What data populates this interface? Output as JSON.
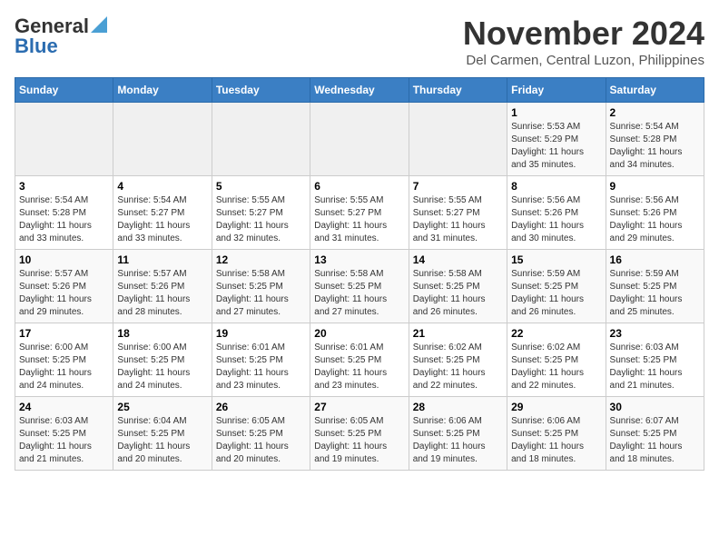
{
  "header": {
    "logo_general": "General",
    "logo_blue": "Blue",
    "month": "November 2024",
    "location": "Del Carmen, Central Luzon, Philippines"
  },
  "days_of_week": [
    "Sunday",
    "Monday",
    "Tuesday",
    "Wednesday",
    "Thursday",
    "Friday",
    "Saturday"
  ],
  "weeks": [
    [
      {
        "day": "",
        "info": ""
      },
      {
        "day": "",
        "info": ""
      },
      {
        "day": "",
        "info": ""
      },
      {
        "day": "",
        "info": ""
      },
      {
        "day": "",
        "info": ""
      },
      {
        "day": "1",
        "info": "Sunrise: 5:53 AM\nSunset: 5:29 PM\nDaylight: 11 hours\nand 35 minutes."
      },
      {
        "day": "2",
        "info": "Sunrise: 5:54 AM\nSunset: 5:28 PM\nDaylight: 11 hours\nand 34 minutes."
      }
    ],
    [
      {
        "day": "3",
        "info": "Sunrise: 5:54 AM\nSunset: 5:28 PM\nDaylight: 11 hours\nand 33 minutes."
      },
      {
        "day": "4",
        "info": "Sunrise: 5:54 AM\nSunset: 5:27 PM\nDaylight: 11 hours\nand 33 minutes."
      },
      {
        "day": "5",
        "info": "Sunrise: 5:55 AM\nSunset: 5:27 PM\nDaylight: 11 hours\nand 32 minutes."
      },
      {
        "day": "6",
        "info": "Sunrise: 5:55 AM\nSunset: 5:27 PM\nDaylight: 11 hours\nand 31 minutes."
      },
      {
        "day": "7",
        "info": "Sunrise: 5:55 AM\nSunset: 5:27 PM\nDaylight: 11 hours\nand 31 minutes."
      },
      {
        "day": "8",
        "info": "Sunrise: 5:56 AM\nSunset: 5:26 PM\nDaylight: 11 hours\nand 30 minutes."
      },
      {
        "day": "9",
        "info": "Sunrise: 5:56 AM\nSunset: 5:26 PM\nDaylight: 11 hours\nand 29 minutes."
      }
    ],
    [
      {
        "day": "10",
        "info": "Sunrise: 5:57 AM\nSunset: 5:26 PM\nDaylight: 11 hours\nand 29 minutes."
      },
      {
        "day": "11",
        "info": "Sunrise: 5:57 AM\nSunset: 5:26 PM\nDaylight: 11 hours\nand 28 minutes."
      },
      {
        "day": "12",
        "info": "Sunrise: 5:58 AM\nSunset: 5:25 PM\nDaylight: 11 hours\nand 27 minutes."
      },
      {
        "day": "13",
        "info": "Sunrise: 5:58 AM\nSunset: 5:25 PM\nDaylight: 11 hours\nand 27 minutes."
      },
      {
        "day": "14",
        "info": "Sunrise: 5:58 AM\nSunset: 5:25 PM\nDaylight: 11 hours\nand 26 minutes."
      },
      {
        "day": "15",
        "info": "Sunrise: 5:59 AM\nSunset: 5:25 PM\nDaylight: 11 hours\nand 26 minutes."
      },
      {
        "day": "16",
        "info": "Sunrise: 5:59 AM\nSunset: 5:25 PM\nDaylight: 11 hours\nand 25 minutes."
      }
    ],
    [
      {
        "day": "17",
        "info": "Sunrise: 6:00 AM\nSunset: 5:25 PM\nDaylight: 11 hours\nand 24 minutes."
      },
      {
        "day": "18",
        "info": "Sunrise: 6:00 AM\nSunset: 5:25 PM\nDaylight: 11 hours\nand 24 minutes."
      },
      {
        "day": "19",
        "info": "Sunrise: 6:01 AM\nSunset: 5:25 PM\nDaylight: 11 hours\nand 23 minutes."
      },
      {
        "day": "20",
        "info": "Sunrise: 6:01 AM\nSunset: 5:25 PM\nDaylight: 11 hours\nand 23 minutes."
      },
      {
        "day": "21",
        "info": "Sunrise: 6:02 AM\nSunset: 5:25 PM\nDaylight: 11 hours\nand 22 minutes."
      },
      {
        "day": "22",
        "info": "Sunrise: 6:02 AM\nSunset: 5:25 PM\nDaylight: 11 hours\nand 22 minutes."
      },
      {
        "day": "23",
        "info": "Sunrise: 6:03 AM\nSunset: 5:25 PM\nDaylight: 11 hours\nand 21 minutes."
      }
    ],
    [
      {
        "day": "24",
        "info": "Sunrise: 6:03 AM\nSunset: 5:25 PM\nDaylight: 11 hours\nand 21 minutes."
      },
      {
        "day": "25",
        "info": "Sunrise: 6:04 AM\nSunset: 5:25 PM\nDaylight: 11 hours\nand 20 minutes."
      },
      {
        "day": "26",
        "info": "Sunrise: 6:05 AM\nSunset: 5:25 PM\nDaylight: 11 hours\nand 20 minutes."
      },
      {
        "day": "27",
        "info": "Sunrise: 6:05 AM\nSunset: 5:25 PM\nDaylight: 11 hours\nand 19 minutes."
      },
      {
        "day": "28",
        "info": "Sunrise: 6:06 AM\nSunset: 5:25 PM\nDaylight: 11 hours\nand 19 minutes."
      },
      {
        "day": "29",
        "info": "Sunrise: 6:06 AM\nSunset: 5:25 PM\nDaylight: 11 hours\nand 18 minutes."
      },
      {
        "day": "30",
        "info": "Sunrise: 6:07 AM\nSunset: 5:25 PM\nDaylight: 11 hours\nand 18 minutes."
      }
    ]
  ]
}
